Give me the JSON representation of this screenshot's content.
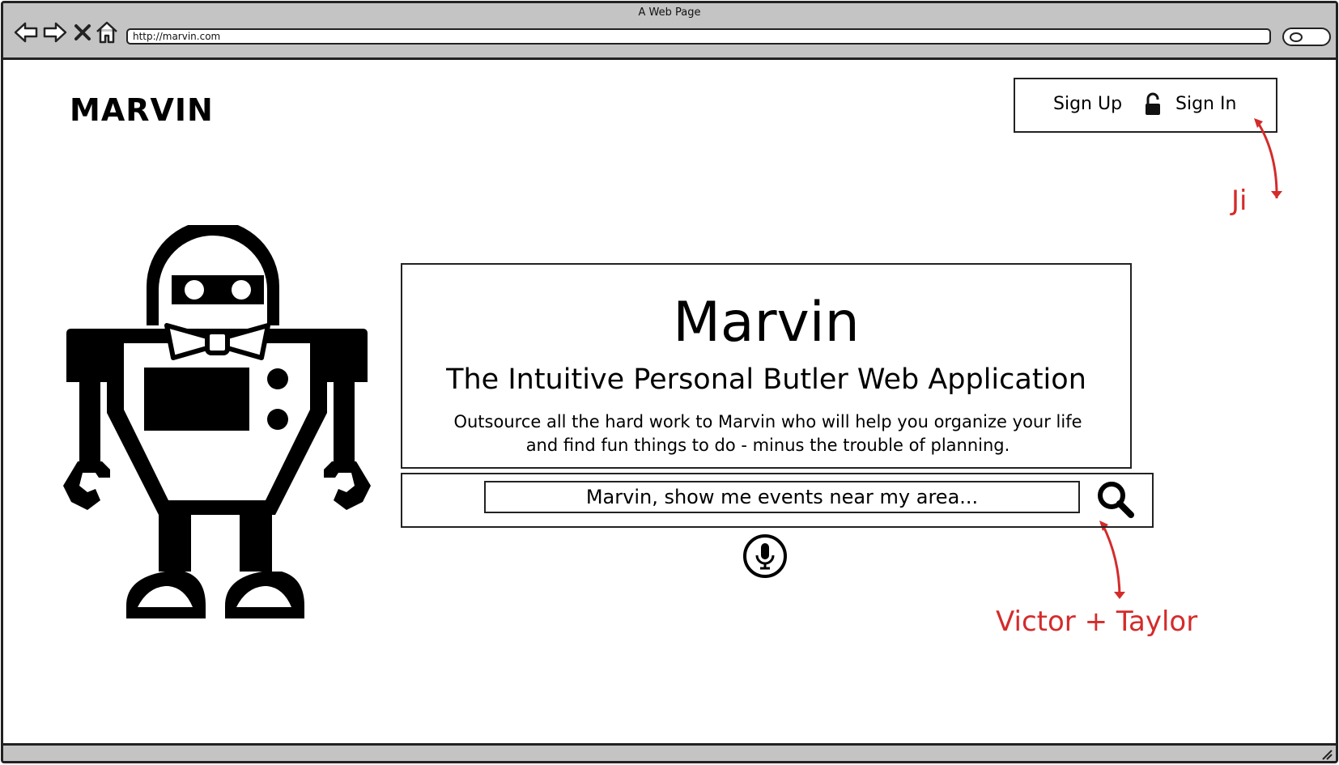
{
  "window": {
    "title": "A Web Page",
    "url": "http://marvin.com"
  },
  "toolbar_icons": [
    "back-arrow-icon",
    "forward-arrow-icon",
    "stop-icon",
    "home-icon",
    "search-icon"
  ],
  "header": {
    "brand": "MARVIN",
    "auth": {
      "sign_up": "Sign Up",
      "sign_in": "Sign In",
      "icon": "unlocked-padlock-icon"
    }
  },
  "hero": {
    "title": "Marvin",
    "subtitle": "The Intuitive Personal Butler Web Application",
    "description": "Outsource all the hard work to Marvin who will help you organize your life and find fun things to do - minus the trouble of planning."
  },
  "search": {
    "placeholder": "Marvin, show me events near my area...",
    "button_icon": "magnifier-icon",
    "voice_icon": "microphone-icon"
  },
  "annotations": {
    "sign_in_owner": "Ji",
    "search_owner": "Victor + Taylor",
    "color": "#d42b2b"
  }
}
